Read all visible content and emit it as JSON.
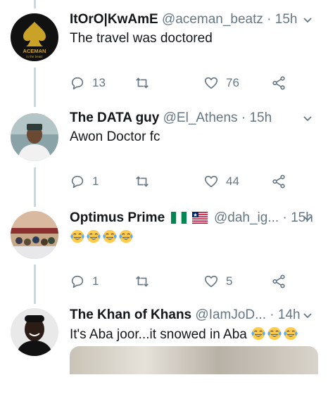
{
  "tweets": [
    {
      "name": "ItOrO|KwAmE",
      "handle": "@aceman_beatz",
      "dot": "·",
      "time": "15h",
      "text": "The travel was doctored",
      "replies": "13",
      "retweets": "",
      "likes": "76",
      "avatar_text": "ACEMAN",
      "avatar_subtext": "in the beatz"
    },
    {
      "name": "The DATA guy",
      "handle": "@El_Athens",
      "dot": "·",
      "time": "15h",
      "text": "Awon Doctor fc",
      "replies": "1",
      "retweets": "",
      "likes": "44"
    },
    {
      "name": "Optimus Prime",
      "handle": "@dah_ig...",
      "dot": "·",
      "time": "15h",
      "text": "",
      "emoji_count": 4,
      "replies": "1",
      "retweets": "",
      "likes": "5"
    },
    {
      "name": "The Khan of Khans",
      "handle": "@IamJoD...",
      "dot": "·",
      "time": "14h",
      "text": "It's Aba joor...it snowed in Aba",
      "emoji_count": 3
    }
  ],
  "colors": {
    "muted": "#657786",
    "line": "#ccd6dd",
    "emoji_face": "#ffcc4d"
  },
  "icons": [
    "reply-icon",
    "retweet-icon",
    "like-icon",
    "share-icon",
    "chevron-down-icon",
    "tears-of-joy-emoji"
  ]
}
